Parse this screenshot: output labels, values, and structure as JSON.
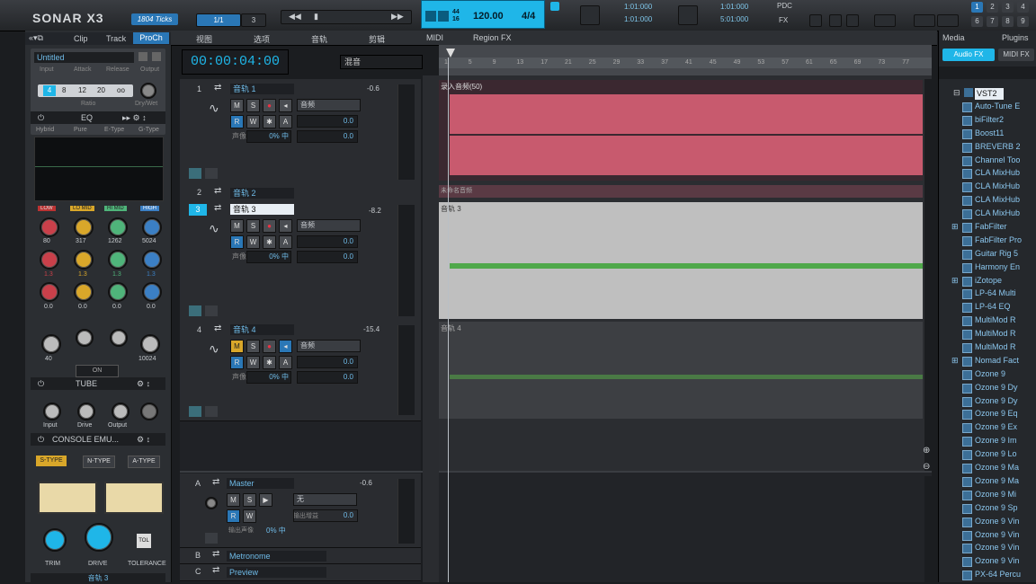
{
  "app": {
    "name": "SONAR X3",
    "ticks": "1804 Ticks"
  },
  "transport": {
    "time": "00:00:04:00",
    "tempo": "120.00",
    "meter": "4/4",
    "sig_top": "44",
    "sig_bottom": "16",
    "pos_a": "1:01:000",
    "pos_b": "1:01:000",
    "pos_c": "1:01:000",
    "pos_d": "5:01:000",
    "fx_labels": [
      "PDC",
      "FX"
    ],
    "field_a": "1/1",
    "field_b": "3"
  },
  "inspector": {
    "tabs": [
      "Clip",
      "Track",
      "ProCh"
    ],
    "preset": "Untitled",
    "comp_labels": [
      "Input",
      "Attack",
      "Release",
      "Output"
    ],
    "ratio_values": [
      "4",
      "8",
      "12",
      "20",
      "oo"
    ],
    "ratio_label": "Ratio",
    "drywet_label": "Dry/Wet",
    "eq_title": "EQ",
    "eq_modes": [
      "Hybrid",
      "Pure",
      "E-Type",
      "G-Type"
    ],
    "eq_bands": [
      "LOW",
      "LO MID",
      "HI MID",
      "HIGH"
    ],
    "eq_freqs": [
      "80",
      "317",
      "1262",
      "5024"
    ],
    "eq_gains": [
      "1.3",
      "1.3",
      "1.3",
      "1.3"
    ],
    "eq_q": [
      "0.0",
      "0.0",
      "0.0",
      "0.0"
    ],
    "eq_hp": "40",
    "eq_lp": "10024",
    "eq_on": "ON",
    "tube_title": "TUBE",
    "tube_knobs": [
      "Input",
      "Drive",
      "Output"
    ],
    "console_title": "CONSOLE EMU...",
    "console_types": [
      "S-TYPE",
      "N-TYPE",
      "A-TYPE"
    ],
    "console_knobs": [
      "TRIM",
      "DRIVE",
      "TOLERANCE"
    ],
    "console_btn": "TOL",
    "footer": "音轨 3"
  },
  "toolbar": {
    "menus": [
      "视图",
      "选项",
      "音轨",
      "剪辑",
      "MIDI",
      "Region FX"
    ],
    "select": "混音"
  },
  "tracks": [
    {
      "num": "1",
      "name": "音轨 1",
      "vol": "-0.6",
      "pan_label": "声像",
      "pan": "0% 中",
      "fx": "音频",
      "gain": "0.0",
      "trim": "0.0"
    },
    {
      "num": "2",
      "name": "音轨 2"
    },
    {
      "num": "3",
      "name": "音轨 3",
      "vol": "-8.2",
      "pan_label": "声像",
      "pan": "0% 中",
      "fx": "音频",
      "gain": "0.0",
      "trim": "0.0"
    },
    {
      "num": "4",
      "name": "音轨 4",
      "vol": "-15.4",
      "pan_label": "声像",
      "pan": "0% 中",
      "fx": "音频",
      "gain": "0.0",
      "trim": "0.0"
    }
  ],
  "buses": [
    {
      "letter": "A",
      "name": "Master",
      "vol": "-0.6",
      "out": "无",
      "out_label": "输出增益",
      "gain": "0.0",
      "pan_label": "输出声像",
      "pan": "0% 中"
    },
    {
      "letter": "B",
      "name": "Metronome"
    },
    {
      "letter": "C",
      "name": "Preview"
    }
  ],
  "clips": {
    "clip1": "录入音频(50)",
    "clip3": "音轨 3",
    "clip4": "音轨 4",
    "clip2": "未命名音频"
  },
  "ruler": [
    "1",
    "5",
    "9",
    "13",
    "17",
    "21",
    "25",
    "29",
    "33",
    "37",
    "41",
    "45",
    "49",
    "53",
    "57",
    "61",
    "65",
    "69",
    "73",
    "77"
  ],
  "browser": {
    "tabs": [
      "Media",
      "Plugins"
    ],
    "subtabs": [
      "Audio FX",
      "MIDI FX"
    ],
    "root": "VST2",
    "items": [
      {
        "label": "Auto-Tune E",
        "folder": false
      },
      {
        "label": "biFilter2",
        "folder": false
      },
      {
        "label": "Boost11",
        "folder": false
      },
      {
        "label": "BREVERB 2",
        "folder": false
      },
      {
        "label": "Channel Too",
        "folder": false
      },
      {
        "label": "CLA MixHub",
        "folder": false
      },
      {
        "label": "CLA MixHub",
        "folder": false
      },
      {
        "label": "CLA MixHub",
        "folder": false
      },
      {
        "label": "CLA MixHub",
        "folder": false
      },
      {
        "label": "FabFilter",
        "folder": true
      },
      {
        "label": "FabFilter Pro",
        "folder": false
      },
      {
        "label": "Guitar Rig 5",
        "folder": false
      },
      {
        "label": "Harmony En",
        "folder": false
      },
      {
        "label": "iZotope",
        "folder": true
      },
      {
        "label": "LP-64 Multi",
        "folder": false
      },
      {
        "label": "LP-64 EQ",
        "folder": false
      },
      {
        "label": "MultiMod R",
        "folder": false
      },
      {
        "label": "MultiMod R",
        "folder": false
      },
      {
        "label": "MultiMod R",
        "folder": false
      },
      {
        "label": "Nomad Fact",
        "folder": true
      },
      {
        "label": "Ozone 9",
        "folder": false
      },
      {
        "label": "Ozone 9 Dy",
        "folder": false
      },
      {
        "label": "Ozone 9 Dy",
        "folder": false
      },
      {
        "label": "Ozone 9 Eq",
        "folder": false
      },
      {
        "label": "Ozone 9 Ex",
        "folder": false
      },
      {
        "label": "Ozone 9 Im",
        "folder": false
      },
      {
        "label": "Ozone 9 Lo",
        "folder": false
      },
      {
        "label": "Ozone 9 Ma",
        "folder": false
      },
      {
        "label": "Ozone 9 Ma",
        "folder": false
      },
      {
        "label": "Ozone 9 Mi",
        "folder": false
      },
      {
        "label": "Ozone 9 Sp",
        "folder": false
      },
      {
        "label": "Ozone 9 Vin",
        "folder": false
      },
      {
        "label": "Ozone 9 Vin",
        "folder": false
      },
      {
        "label": "Ozone 9 Vin",
        "folder": false
      },
      {
        "label": "Ozone 9 Vin",
        "folder": false
      },
      {
        "label": "PX-64 Percu",
        "folder": false
      }
    ]
  },
  "colors": {
    "accent": "#1fb6e8",
    "clip_red": "#c85a6e",
    "clip_green": "#4fa84a",
    "clip_gray": "#bfbfbf"
  }
}
